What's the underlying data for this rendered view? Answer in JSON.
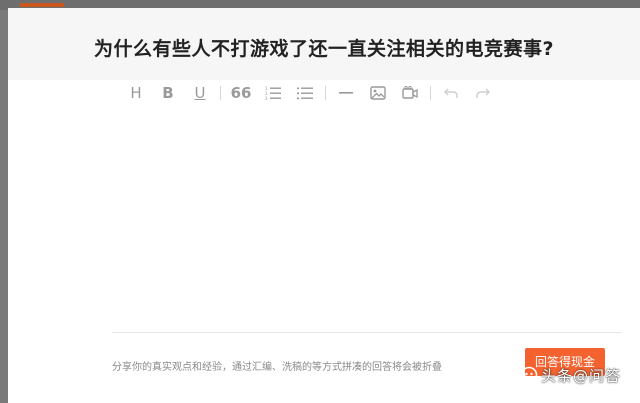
{
  "question": {
    "title": "为什么有些人不打游戏了还一直关注相关的电竞赛事?"
  },
  "toolbar": {
    "heading_label": "H",
    "bold_label": "B",
    "underline_label": "U",
    "quote_label": "66",
    "tools": [
      "heading",
      "bold",
      "underline",
      "quote",
      "ordered-list",
      "unordered-list",
      "horizontal-rule",
      "image",
      "video",
      "undo",
      "redo"
    ]
  },
  "footer": {
    "hint": "分享你的真实观点和经验，通过汇编、洗稿的等方式拼凑的回答将会被折叠",
    "submit_label": "回答得现金"
  },
  "watermark": {
    "text": "头条@问答"
  },
  "colors": {
    "accent": "#f4622f",
    "header_bg": "#f6f6f6",
    "icon": "#9a9a9a",
    "icon_disabled": "#d0d0d0"
  }
}
